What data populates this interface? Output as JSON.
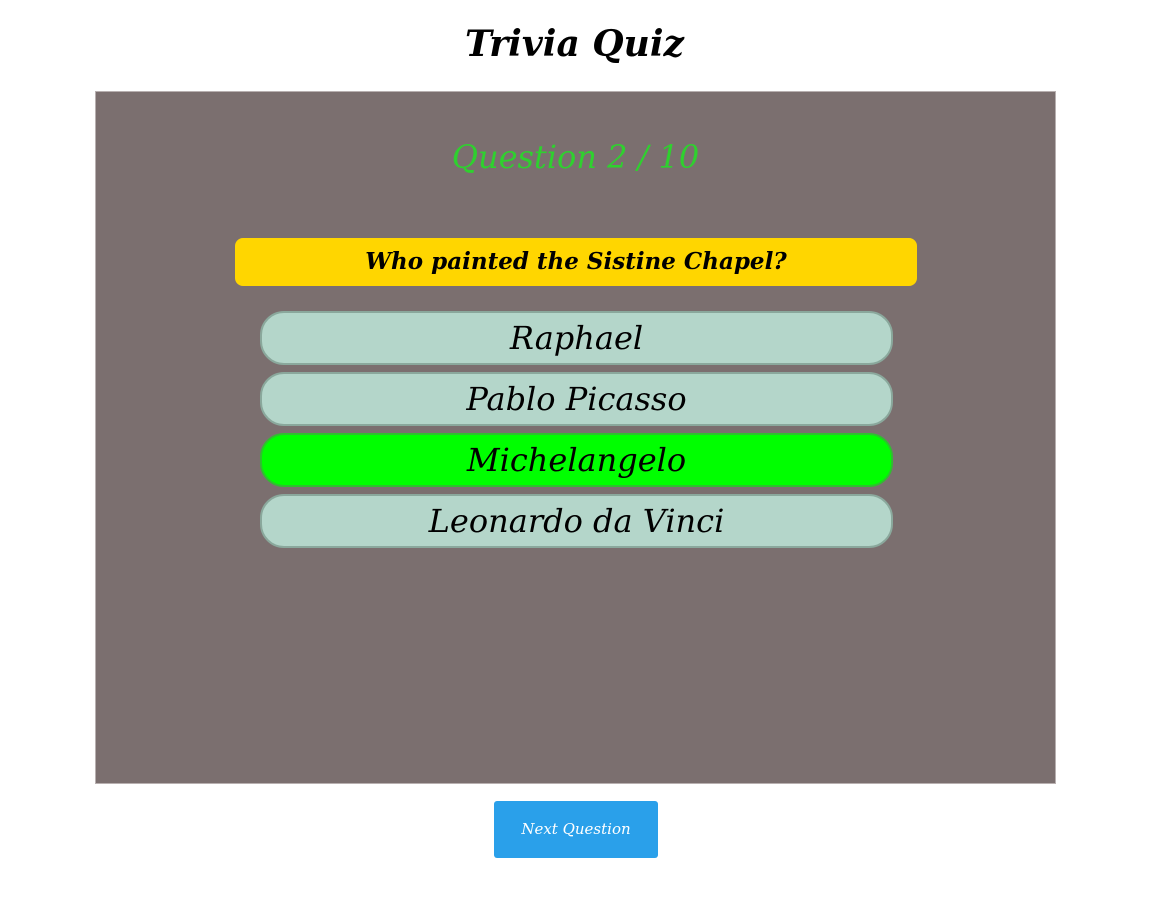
{
  "header": {
    "title": "Trivia Quiz"
  },
  "quiz": {
    "counter": "Question 2 / 10",
    "question": "Who painted the Sistine Chapel?",
    "answers": [
      {
        "label": "Raphael",
        "state": "default"
      },
      {
        "label": "Pablo Picasso",
        "state": "default"
      },
      {
        "label": "Michelangelo",
        "state": "correct"
      },
      {
        "label": "Leonardo da Vinci",
        "state": "default"
      }
    ]
  },
  "footer": {
    "next_label": "Next Question"
  },
  "colors": {
    "panel": "#7b6f6f",
    "counter": "#2fd02f",
    "question_bg": "#ffd600",
    "answer_bg": "#b4d6ca",
    "correct_bg": "#00ff00",
    "button_bg": "#2aa0ea"
  }
}
